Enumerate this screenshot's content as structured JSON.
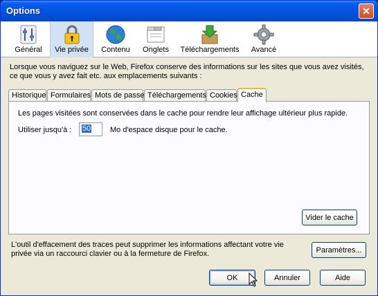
{
  "window": {
    "title": "Options",
    "close_glyph": "✕"
  },
  "panes": [
    {
      "label": "Général",
      "icon": "general-sliders-icon",
      "selected": false
    },
    {
      "label": "Vie privée",
      "icon": "padlock-icon",
      "selected": true
    },
    {
      "label": "Contenu",
      "icon": "globe-icon",
      "selected": false
    },
    {
      "label": "Onglets",
      "icon": "tabs-window-icon",
      "selected": false
    },
    {
      "label": "Téléchargements",
      "icon": "download-box-icon",
      "selected": false
    },
    {
      "label": "Avancé",
      "icon": "gear-icon",
      "selected": false
    }
  ],
  "description": "Lorsque vous naviguez sur le Web, Firefox conserve des informations sur les sites que vous avez visités, ce que vous y avez fait etc. aux emplacements suivants :",
  "tabs": [
    {
      "label": "Historique"
    },
    {
      "label": "Formulaires"
    },
    {
      "label": "Mots de passe"
    },
    {
      "label": "Téléchargements"
    },
    {
      "label": "Cookies"
    },
    {
      "label": "Cache",
      "active": true
    }
  ],
  "cache": {
    "text": "Les pages visitées sont conservées dans le cache pour rendre leur affichage ultérieur plus rapide.",
    "limit_label": "Utiliser jusqu'à :",
    "limit_value": "50",
    "limit_unit": "Mo d'espace disque pour le cache.",
    "clear_button": "Vider le cache"
  },
  "footer": {
    "text": "L'outil d'effacement des traces peut supprimer les informations affectant votre vie privée via un raccourci clavier ou à la fermeture de Firefox.",
    "settings_button": "Paramètres..."
  },
  "dialog_buttons": {
    "ok": "OK",
    "cancel": "Annuler",
    "help": "Aide"
  },
  "colors": {
    "titlebar": "#0554e3",
    "selected_pane": "#d3e1f5",
    "active_tab_accent": "#f1b33f"
  }
}
